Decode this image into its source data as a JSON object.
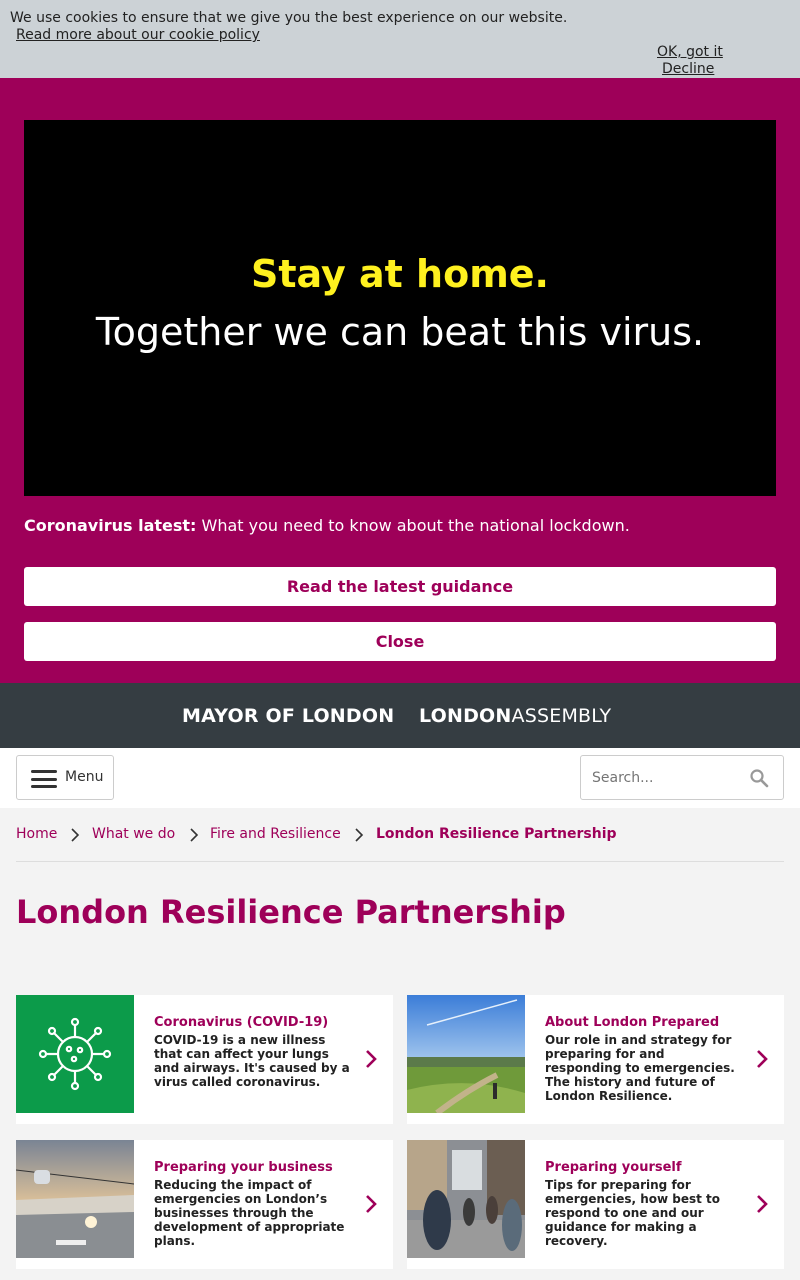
{
  "cookie": {
    "message": "We use cookies to ensure that we give you the best experience on our website.",
    "policy_link": "Read more about our cookie policy",
    "ok": "OK, got it",
    "decline": "Decline"
  },
  "covid": {
    "video_line1": "Stay at home.",
    "video_line2": "Together we can beat this virus.",
    "latest_label": "Coronavirus latest:",
    "latest_text": " What you need to know about the national lockdown.",
    "read_button": "Read the latest guidance",
    "close_button": "Close"
  },
  "logos": {
    "mayor": "MAYOR OF LONDON",
    "assembly_bold": "LONDON",
    "assembly_light": "ASSEMBLY"
  },
  "nav": {
    "menu_label": "Menu",
    "search_placeholder": "Search..."
  },
  "breadcrumb": [
    "Home",
    "What we do",
    "Fire and Resilience",
    "London Resilience Partnership"
  ],
  "page_title": "London Resilience Partnership",
  "cards": [
    {
      "title": "Coronavirus (COVID-19)",
      "description": "COVID-19 is a new illness that can affect your lungs and airways. It's caused by a virus called coronavirus."
    },
    {
      "title": "About London Prepared",
      "description": "Our role in and strategy for preparing for and responding to emergencies. The history and future of London Resilience."
    },
    {
      "title": "Preparing your business",
      "description": "Reducing the impact of emergencies on London’s businesses through the development of appropriate plans."
    },
    {
      "title": "Preparing yourself",
      "description": "Tips for preparing for emergencies, how best to respond to one and our guidance for making a recovery."
    }
  ],
  "colors": {
    "brand": "#9e0059",
    "covid_green": "#0c9b4a",
    "dark_bar": "#353d42"
  },
  "icons": [
    "hamburger-icon",
    "search-icon",
    "chevron-right-icon",
    "virus-icon"
  ]
}
